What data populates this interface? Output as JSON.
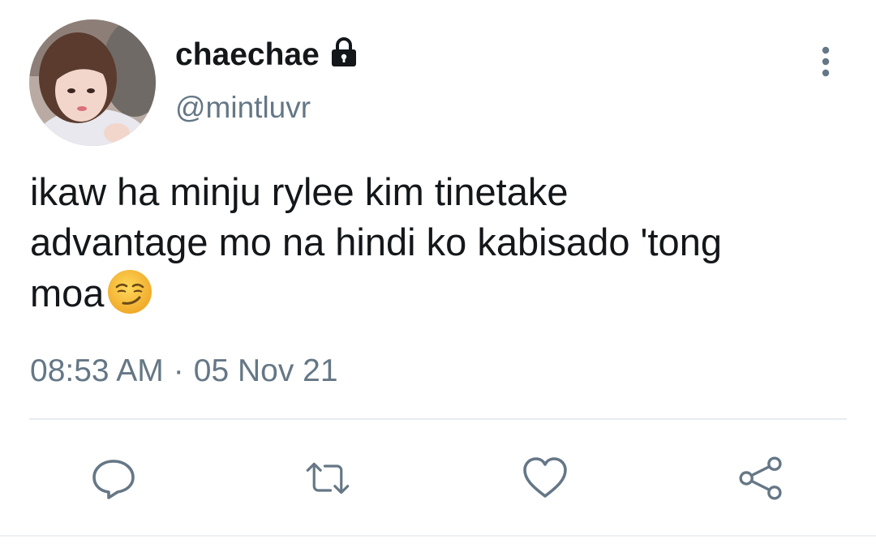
{
  "tweet": {
    "display_name": "chaechae",
    "handle": "@mintluvr",
    "text_lines": [
      "ikaw ha minju rylee kim tinetake",
      "advantage mo na hindi ko kabisado 'tong",
      "moa"
    ],
    "emoji": "smirking-face",
    "time": "08:53 AM",
    "separator": "·",
    "date": "05 Nov 21",
    "protected_icon": "lock-icon",
    "menu_icon": "more-vertical-icon"
  },
  "actions": [
    {
      "name": "reply",
      "icon": "comment-icon"
    },
    {
      "name": "retweet",
      "icon": "retweet-icon"
    },
    {
      "name": "like",
      "icon": "heart-icon"
    },
    {
      "name": "share",
      "icon": "share-icon"
    }
  ],
  "colors": {
    "text_primary": "#14171a",
    "text_secondary": "#657786",
    "divider": "#e6ecf0",
    "emoji_fill": "#f7c23c"
  }
}
